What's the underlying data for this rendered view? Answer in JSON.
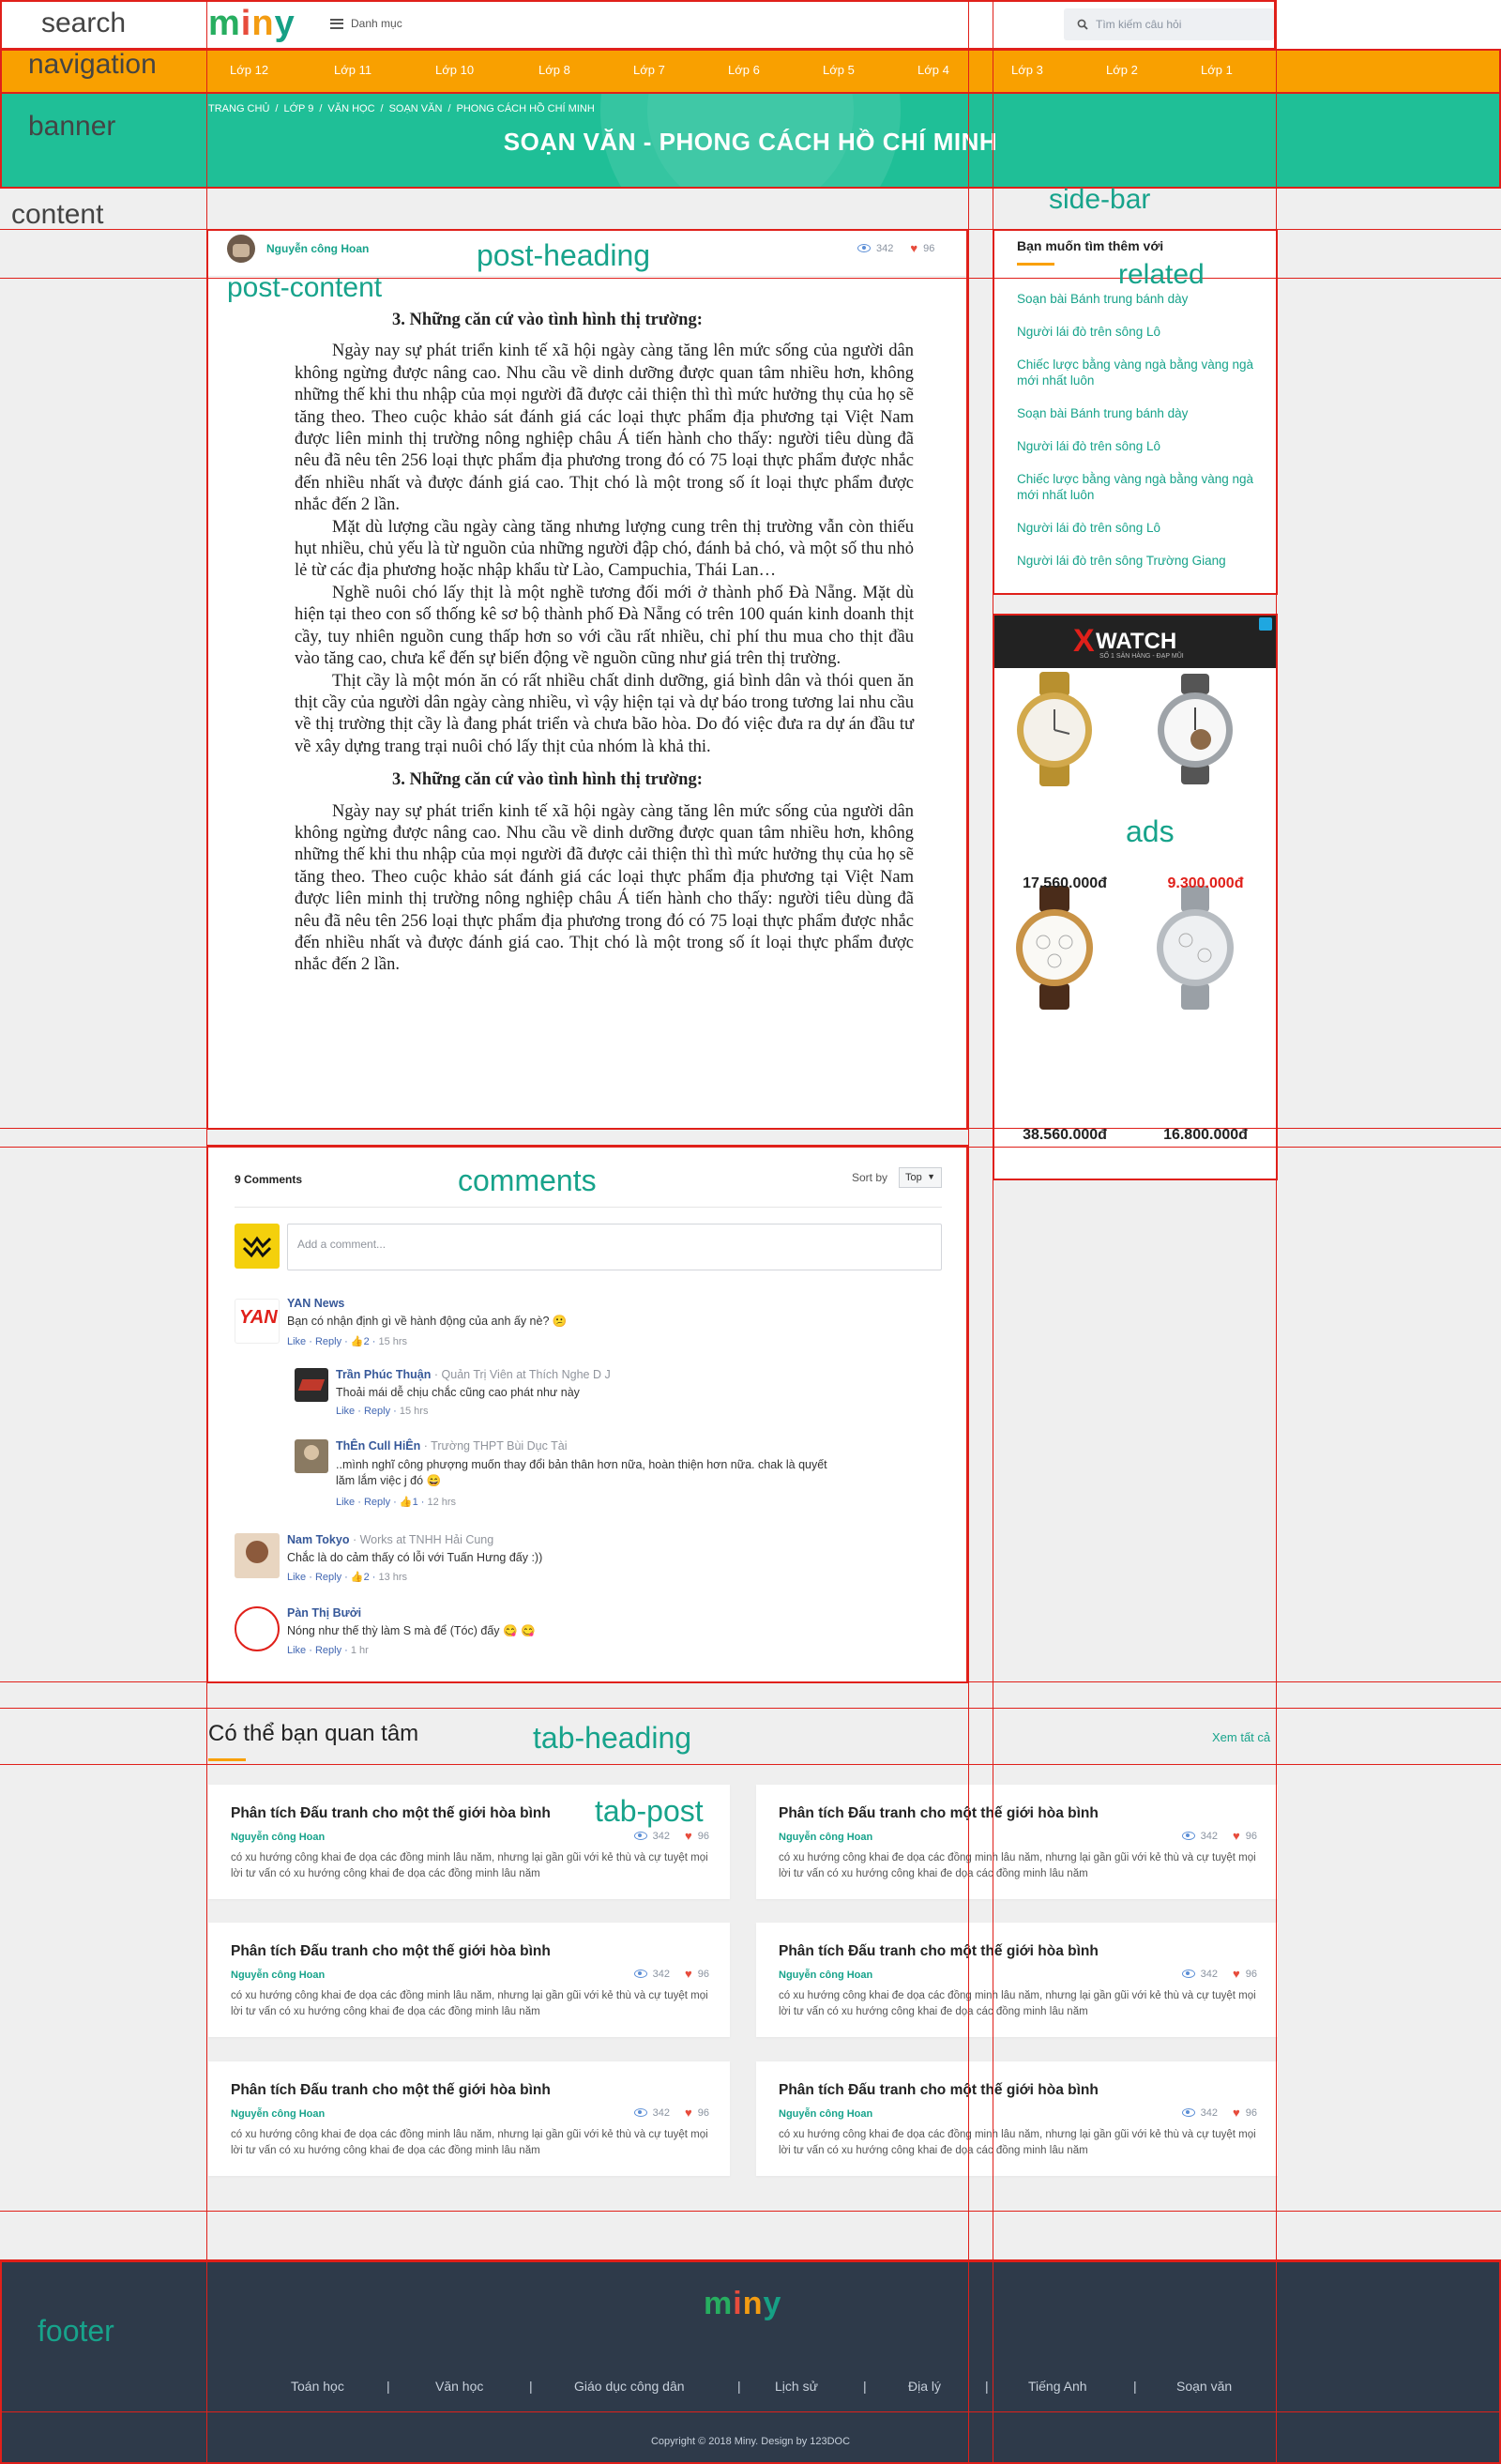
{
  "zone_labels": {
    "search": "search",
    "navigation": "navigation",
    "banner": "banner",
    "content": "content",
    "side_bar": "side-bar",
    "post_heading": "post-heading",
    "post_content": "post-content",
    "related": "related",
    "ads": "ads",
    "comments": "comments",
    "tab_heading": "tab-heading",
    "tab_post": "tab-post",
    "footer": "footer"
  },
  "header": {
    "logo": {
      "m": "m",
      "i": "i",
      "n": "n",
      "y": "y"
    },
    "menu_label": "Danh mục",
    "search_placeholder": "Tìm kiếm câu hỏi"
  },
  "nav": {
    "items": [
      "Lớp 12",
      "Lớp 11",
      "Lớp 10",
      "Lớp 8",
      "Lớp 7",
      "Lớp 6",
      "Lớp 5",
      "Lớp 4",
      "Lớp 3",
      "Lớp 2",
      "Lớp 1"
    ]
  },
  "banner": {
    "breadcrumb": [
      "TRANG CHỦ",
      "LỚP 9",
      "VĂN HỌC",
      "SOẠN VĂN",
      "PHONG CÁCH HỒ CHÍ MINH"
    ],
    "separator": "/",
    "title": "SOẠN VĂN - PHONG CÁCH HỒ CHÍ MINH"
  },
  "post": {
    "author": "Nguyễn công Hoan",
    "views": "342",
    "likes": "96",
    "heading_1": "3. Những căn cứ vào tình hình thị trường:",
    "paragraphs_1": [
      "Ngày nay sự phát triển kinh tế xã hội ngày càng tăng lên mức sống của người dân không ngừng được nâng cao. Nhu cầu về dinh dưỡng được quan tâm nhiều hơn, không những thế khi thu nhập của mọi người đã được cải thiện thì thì mức hưởng thụ của họ sẽ tăng theo. Theo cuộc khảo sát đánh giá các loại thực phẩm địa phương tại Việt Nam được liên minh thị trường nông nghiệp châu Á tiến hành cho thấy: người tiêu dùng đã nêu đã nêu tên 256 loại thực phẩm địa phương trong đó có 75 loại thực phẩm được nhắc đến nhiều nhất và được đánh giá cao. Thịt chó là một trong số ít loại thực phẩm được nhắc đến 2 lần.",
      "Mặt dù lượng cầu ngày càng tăng nhưng lượng cung trên thị trường vẫn còn thiếu hụt nhiều, chủ yếu là từ nguồn của những người đập chó, đánh bả chó, và một số thu nhỏ lẻ từ các địa phương hoặc nhập khẩu từ Lào, Campuchia, Thái Lan…",
      "Nghề nuôi chó lấy thịt là một nghề tương đối mới ở thành phố Đà Nẵng. Mặt dù hiện tại theo con số thống kê sơ bộ thành phố Đà Nẵng có trên 100 quán kinh doanh thịt cầy, tuy nhiên nguồn cung thấp hơn so với cầu rất nhiều, chỉ phí thu mua cho thịt đầu vào tăng cao, chưa kể đến sự biến động về nguồn cũng như giá trên thị trường.",
      "Thịt cầy là một món ăn có rất nhiều chất dinh dưỡng, giá bình dân và thói quen ăn thịt cầy của người dân ngày càng nhiều, vì vậy hiện tại và dự báo trong tương lai nhu cầu về thị trường thịt cầy là đang phát triển và chưa bão hòa. Do đó việc đưa ra dự án đầu tư về xây dựng trang trại nuôi chó lấy thịt của nhóm là khả thi."
    ],
    "heading_2": "3. Những căn cứ vào tình hình thị trường:",
    "paragraphs_2": [
      "Ngày nay sự phát triển kinh tế xã hội ngày càng tăng lên mức sống của người dân không ngừng được nâng cao. Nhu cầu về dinh dưỡng được quan tâm nhiều hơn, không những thế khi thu nhập của mọi người đã được cải thiện thì thì mức hưởng thụ của họ sẽ tăng theo. Theo cuộc khảo sát đánh giá các loại thực phẩm địa phương tại Việt Nam được liên minh thị trường nông nghiệp châu Á tiến hành cho thấy: người tiêu dùng đã nêu đã nêu tên 256 loại thực phẩm địa phương trong đó có 75 loại thực phẩm được nhắc đến nhiều nhất và được đánh giá cao. Thịt chó là một trong số ít loại thực phẩm được nhắc đến 2 lần."
    ]
  },
  "related": {
    "title": "Bạn muốn tìm thêm với",
    "links": [
      "Soạn bài Bánh trung bánh dày",
      "Người lái đò trên sông Lô",
      "Chiếc lược bằng vàng ngà bằng vàng ngà mới nhất luôn",
      "Soạn bài Bánh trung bánh dày",
      "Người lái đò trên sông Lô",
      "Chiếc lược bằng vàng ngà bằng vàng ngà mới nhất luôn",
      "Người lái đò trên sông Lô",
      "Người lái đò trên sông Trường Giang"
    ]
  },
  "ad": {
    "brand": "WATCH",
    "brand_x": "X",
    "tagline": "SỐ 1 SẢN HÀNG - ĐẠP MŨI",
    "prices": [
      "17.560.000đ",
      "9.300.000đ",
      "38.560.000đ",
      "16.800.000đ"
    ],
    "price_colors": [
      "#222222",
      "#e0201a",
      "#222222",
      "#222222"
    ]
  },
  "comments": {
    "count": "9 Comments",
    "sort_label": "Sort by",
    "sort_value": "Top",
    "placeholder": "Add a comment...",
    "like": "Like",
    "reply": "Reply",
    "dot": "·",
    "items": [
      {
        "name": "YAN News",
        "sub": "",
        "text": "Bạn có nhận định gì về hành động của anh ấy nè? 😕",
        "likes": "2",
        "time": "15 hrs"
      },
      {
        "name": "Trần Phúc Thuận",
        "sub": "· Quản Trị Viên at Thích Nghe D J",
        "text": "Thoải mái dễ chịu chắc cũng cao phát như này",
        "likes": "",
        "time": "15 hrs"
      },
      {
        "name": "ThÊn Cull HiÊn",
        "sub": "· Trường THPT Bùi Dục Tài",
        "text": "..mình nghĩ công phượng muốn thay đổi bản thân hơn nữa, hoàn thiện hơn nữa. chak là quyết lăm lắm việc j đó 😄",
        "likes": "1",
        "time": "12 hrs"
      },
      {
        "name": "Nam Tokyo",
        "sub": "· Works at TNHH Hải Cung",
        "text": "Chắc là do cảm thấy có lỗi với Tuấn Hưng đấy :))",
        "likes": "2",
        "time": "13 hrs"
      },
      {
        "name": "Pàn Thị Bưởi",
        "sub": "",
        "text": "Nóng như thế thỳ làm S mà để (Tóc) đấy 😋 😋",
        "likes": "",
        "time": "1 hr"
      }
    ]
  },
  "tabs": {
    "heading": "Có thể bạn quan tâm",
    "see_all": "Xem tất cả",
    "cards": [
      {
        "title": "Phân tích Đấu tranh cho một thế giới hòa bình",
        "author": "Nguyễn công Hoan",
        "views": "342",
        "likes": "96",
        "excerpt": "có xu hướng công khai đe dọa các đồng minh lâu năm, nhưng lại gần gũi với kẻ thù và cự tuyệt mọi lời tư vấn có xu hướng công khai đe dọa các đồng minh lâu năm"
      },
      {
        "title": "Phân tích Đấu tranh cho một thế giới hòa bình",
        "author": "Nguyễn công Hoan",
        "views": "342",
        "likes": "96",
        "excerpt": "có xu hướng công khai đe dọa các đồng minh lâu năm, nhưng lại gần gũi với kẻ thù và cự tuyệt mọi lời tư vấn có xu hướng công khai đe dọa các đồng minh lâu năm"
      },
      {
        "title": "Phân tích Đấu tranh cho một thế giới hòa bình",
        "author": "Nguyễn công Hoan",
        "views": "342",
        "likes": "96",
        "excerpt": "có xu hướng công khai đe dọa các đồng minh lâu năm, nhưng lại gần gũi với kẻ thù và cự tuyệt mọi lời tư vấn có xu hướng công khai đe dọa các đồng minh lâu năm"
      },
      {
        "title": "Phân tích Đấu tranh cho một thế giới hòa bình",
        "author": "Nguyễn công Hoan",
        "views": "342",
        "likes": "96",
        "excerpt": "có xu hướng công khai đe dọa các đồng minh lâu năm, nhưng lại gần gũi với kẻ thù và cự tuyệt mọi lời tư vấn có xu hướng công khai đe dọa các đồng minh lâu năm"
      },
      {
        "title": "Phân tích Đấu tranh cho một thế giới hòa bình",
        "author": "Nguyễn công Hoan",
        "views": "342",
        "likes": "96",
        "excerpt": "có xu hướng công khai đe dọa các đồng minh lâu năm, nhưng lại gần gũi với kẻ thù và cự tuyệt mọi lời tư vấn có xu hướng công khai đe dọa các đồng minh lâu năm"
      },
      {
        "title": "Phân tích Đấu tranh cho một thế giới hòa bình",
        "author": "Nguyễn công Hoan",
        "views": "342",
        "likes": "96",
        "excerpt": "có xu hướng công khai đe dọa các đồng minh lâu năm, nhưng lại gần gũi với kẻ thù và cự tuyệt mọi lời tư vấn có xu hướng công khai đe dọa các đồng minh lâu năm"
      }
    ]
  },
  "footer": {
    "links": [
      "Toán học",
      "Văn học",
      "Giáo dục công dân",
      "Lịch sử",
      "Địa lý",
      "Tiếng Anh",
      "Soạn văn"
    ],
    "separator": "|",
    "copyright": "Copyright © 2018 Miny. Design by 123DOC"
  },
  "colors": {
    "nav_orange": "#f9a000",
    "banner_green": "#1fbf97",
    "accent_teal": "#17a38b",
    "guide_red": "#e0201a",
    "footer_navy": "#2e3a4a"
  }
}
